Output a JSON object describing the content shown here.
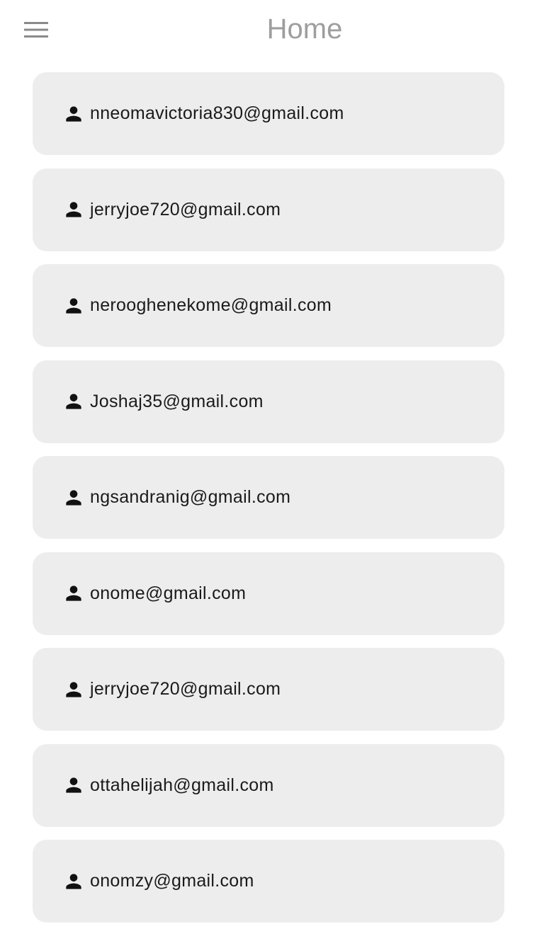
{
  "header": {
    "title": "Home",
    "menu_icon": "hamburger-menu-icon"
  },
  "users": [
    {
      "email": "nneomavictoria830@gmail.com",
      "icon": "person-icon"
    },
    {
      "email": "jerryjoe720@gmail.com",
      "icon": "person-icon"
    },
    {
      "email": "nerooghenekome@gmail.com",
      "icon": "person-icon"
    },
    {
      "email": "Joshaj35@gmail.com",
      "icon": "person-icon"
    },
    {
      "email": "ngsandranig@gmail.com",
      "icon": "person-icon"
    },
    {
      "email": "onome@gmail.com",
      "icon": "person-icon"
    },
    {
      "email": "jerryjoe720@gmail.com",
      "icon": "person-icon"
    },
    {
      "email": "ottahelijah@gmail.com",
      "icon": "person-icon"
    },
    {
      "email": "onomzy@gmail.com",
      "icon": "person-icon"
    }
  ],
  "colors": {
    "card_background": "#ededed",
    "title_color": "#9e9e9e",
    "text_color": "#1a1a1a",
    "icon_color": "#111111"
  }
}
